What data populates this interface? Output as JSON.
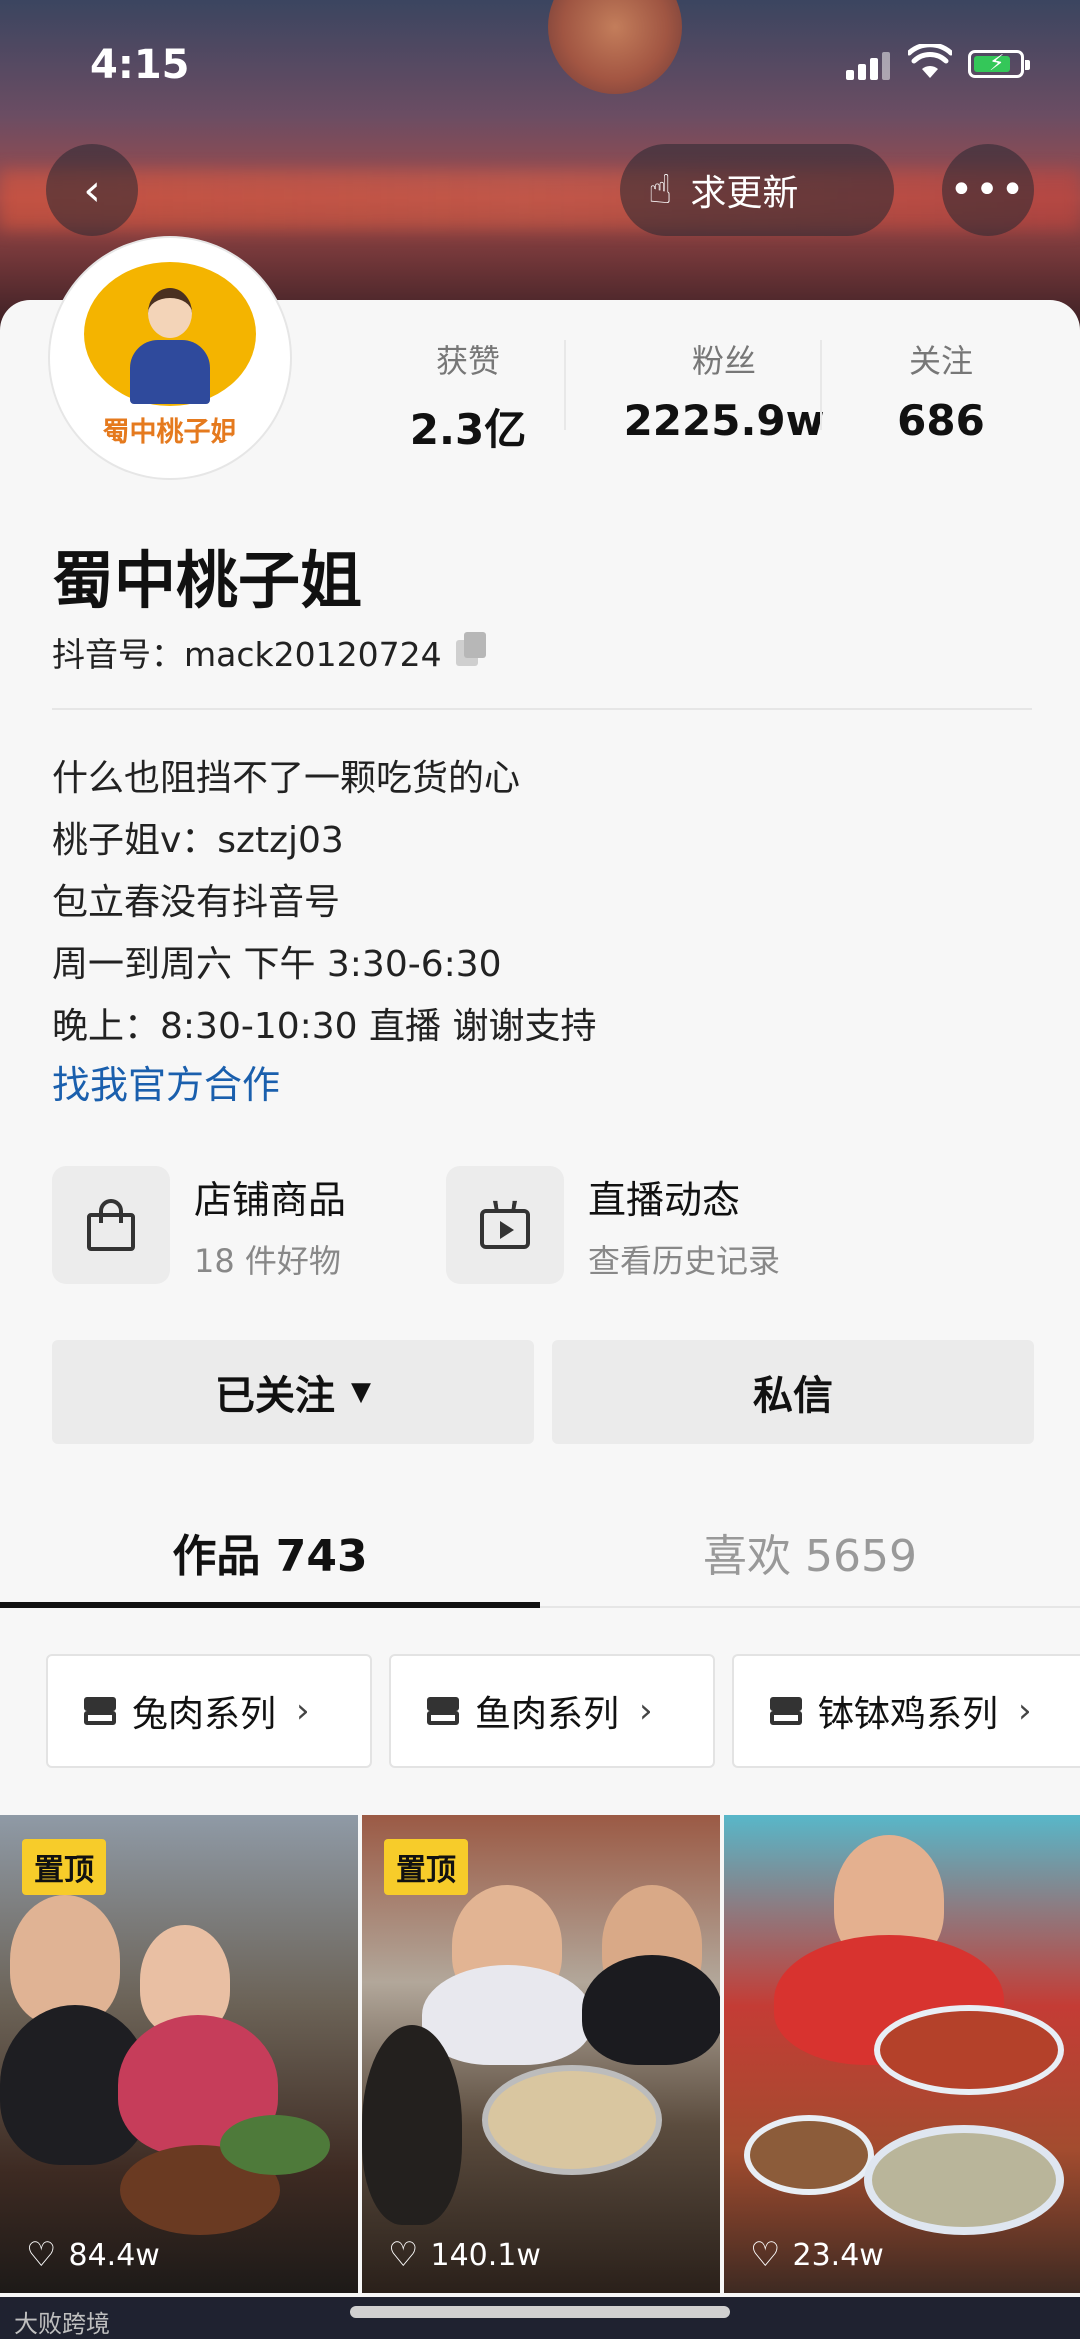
{
  "status_bar": {
    "time": "4:15"
  },
  "header": {
    "update_button_label": "求更新"
  },
  "profile": {
    "name": "蜀中桃子姐",
    "douyin_id": "抖音号：mack20120724",
    "avatar_text": "蜀中桃子姐",
    "stats": [
      {
        "label": "获赞",
        "value": "2.3亿"
      },
      {
        "label": "粉丝",
        "value": "2225.9w"
      },
      {
        "label": "关注",
        "value": "686"
      }
    ],
    "bio_lines": [
      "什么也阻挡不了一颗吃货的心",
      "桃子姐v：sztzj03",
      "包立春没有抖音号",
      "周一到周六 下午 3:30-6:30",
      "晚上：8:30-10:30 直播 谢谢支持"
    ],
    "bio_link": "找我官方合作"
  },
  "features": [
    {
      "title": "店铺商品",
      "subtitle": "18 件好物",
      "icon": "shopping-bag-icon"
    },
    {
      "title": "直播动态",
      "subtitle": "查看历史记录",
      "icon": "live-tv-icon"
    }
  ],
  "actions": {
    "follow_label": "已关注",
    "message_label": "私信"
  },
  "tabs": [
    {
      "label": "作品 743",
      "active": true
    },
    {
      "label": "喜欢 5659",
      "active": false
    }
  ],
  "collections": [
    {
      "label": "兔肉系列"
    },
    {
      "label": "鱼肉系列"
    },
    {
      "label": "钵钵鸡系列"
    }
  ],
  "videos": [
    {
      "pinned_label": "置顶",
      "likes": "84.4w"
    },
    {
      "pinned_label": "置顶",
      "likes": "140.1w"
    },
    {
      "pinned_label": "",
      "likes": "23.4w"
    }
  ],
  "watermark": "大败跨境",
  "colors": {
    "link": "#1a5fad",
    "pin_badge": "#f7cc2a",
    "battery": "#34c759"
  }
}
